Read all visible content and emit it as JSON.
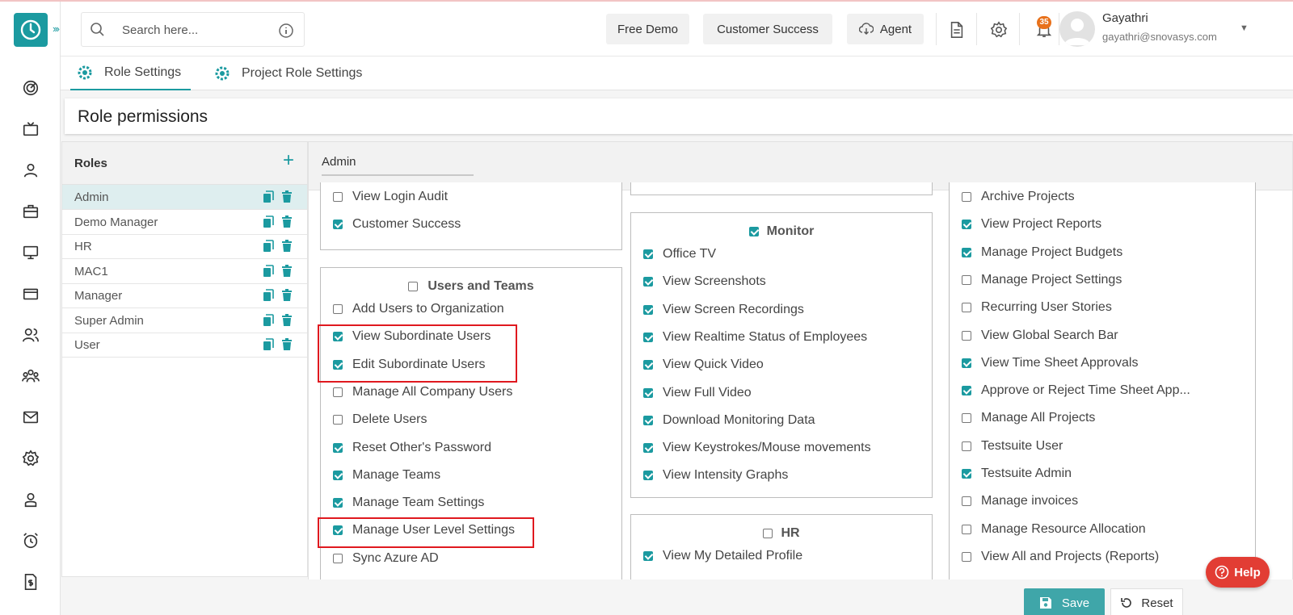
{
  "header": {
    "search_placeholder": "Search here...",
    "free_demo": "Free Demo",
    "customer_success": "Customer Success",
    "agent": "Agent",
    "notification_count": "35",
    "user_name": "Gayathri",
    "user_email": "gayathri@snovasys.com"
  },
  "tabs": [
    {
      "label": "Role Settings",
      "active": true
    },
    {
      "label": "Project Role Settings",
      "active": false
    }
  ],
  "page_title": "Role permissions",
  "roles": {
    "title": "Roles",
    "items": [
      {
        "name": "Admin",
        "active": true
      },
      {
        "name": "Demo Manager"
      },
      {
        "name": "HR"
      },
      {
        "name": "MAC1"
      },
      {
        "name": "Manager"
      },
      {
        "name": "Super Admin"
      },
      {
        "name": "User"
      }
    ]
  },
  "selected_role": "Admin",
  "col1": {
    "top_items": [
      {
        "label": "View Login Audit",
        "checked": false
      },
      {
        "label": "Customer Success",
        "checked": true
      }
    ],
    "users_and_teams": {
      "title": "Users and Teams",
      "checked": false,
      "items": [
        {
          "label": "Add Users to Organization",
          "checked": false
        },
        {
          "label": "View Subordinate Users",
          "checked": true
        },
        {
          "label": "Edit Subordinate Users",
          "checked": true
        },
        {
          "label": "Manage All Company Users",
          "checked": false
        },
        {
          "label": "Delete Users",
          "checked": false
        },
        {
          "label": "Reset Other's Password",
          "checked": true
        },
        {
          "label": "Manage Teams",
          "checked": true
        },
        {
          "label": "Manage Team Settings",
          "checked": true
        },
        {
          "label": "Manage User Level Settings",
          "checked": true
        },
        {
          "label": "Sync Azure AD",
          "checked": false
        }
      ]
    }
  },
  "col2": {
    "monitor": {
      "title": "Monitor",
      "checked": true,
      "items": [
        {
          "label": "Office TV",
          "checked": true
        },
        {
          "label": "View Screenshots",
          "checked": true
        },
        {
          "label": "View Screen Recordings",
          "checked": true
        },
        {
          "label": "View Realtime Status of Employees",
          "checked": true
        },
        {
          "label": "View Quick Video",
          "checked": true
        },
        {
          "label": "View Full Video",
          "checked": true
        },
        {
          "label": "Download Monitoring Data",
          "checked": true
        },
        {
          "label": "View Keystrokes/Mouse movements",
          "checked": true
        },
        {
          "label": "View Intensity Graphs",
          "checked": true
        }
      ]
    },
    "hr": {
      "title": "HR",
      "checked": false,
      "items": [
        {
          "label": "View My Detailed Profile",
          "checked": true
        }
      ]
    }
  },
  "col3": {
    "items": [
      {
        "label": "Archive Projects",
        "checked": false
      },
      {
        "label": "View Project Reports",
        "checked": true
      },
      {
        "label": "Manage Project Budgets",
        "checked": true
      },
      {
        "label": "Manage Project Settings",
        "checked": false
      },
      {
        "label": "Recurring User Stories",
        "checked": false
      },
      {
        "label": "View Global Search Bar",
        "checked": false
      },
      {
        "label": "View Time Sheet Approvals",
        "checked": true
      },
      {
        "label": "Approve or Reject Time Sheet App...",
        "checked": true
      },
      {
        "label": "Manage All Projects",
        "checked": false
      },
      {
        "label": "Testsuite User",
        "checked": false
      },
      {
        "label": "Testsuite Admin",
        "checked": true
      },
      {
        "label": "Manage invoices",
        "checked": false
      },
      {
        "label": "Manage Resource Allocation",
        "checked": false
      },
      {
        "label": "View All and Projects (Reports)",
        "checked": false
      }
    ]
  },
  "footer": {
    "save": "Save",
    "reset": "Reset",
    "help": "Help"
  },
  "colors": {
    "accent": "#1b9aa0",
    "highlight": "#e0191f",
    "help": "#e23d34"
  }
}
